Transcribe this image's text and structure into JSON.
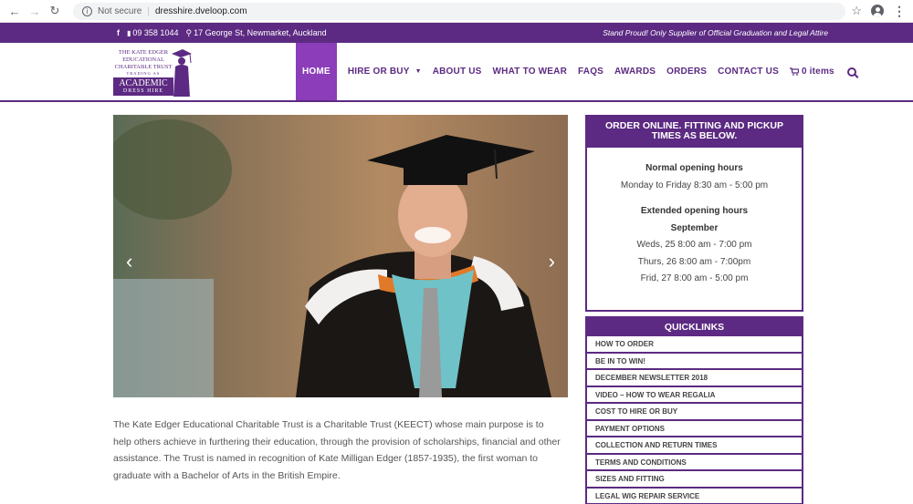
{
  "browser": {
    "not_secure": "Not secure",
    "url": "dresshire.dveloop.com"
  },
  "topbar": {
    "phone": "09 358 1044",
    "address": "17 George St, Newmarket, Auckland",
    "tagline": "Stand Proud! Only Supplier of Official Graduation and Legal Attire"
  },
  "logo": {
    "line1": "THE KATE EDGER",
    "line2": "EDUCATIONAL",
    "line3": "CHARITABLE TRUST",
    "line4": "TRADING AS",
    "block_title": "ACADEMIC",
    "block_sub": "DRESS HIRE"
  },
  "nav": {
    "items": [
      {
        "label": "HOME"
      },
      {
        "label": "HIRE OR BUY"
      },
      {
        "label": "ABOUT US"
      },
      {
        "label": "WHAT TO WEAR"
      },
      {
        "label": "FAQS"
      },
      {
        "label": "AWARDS"
      },
      {
        "label": "ORDERS"
      },
      {
        "label": "CONTACT US"
      }
    ],
    "cart_label": "0 items"
  },
  "hero": {
    "prev_arrow": "‹",
    "next_arrow": "›"
  },
  "main": {
    "paragraph": "The Kate Edger Educational Charitable Trust is a Charitable Trust (KEECT) whose main purpose is to help others achieve in furthering their education, through the provision of scholarships, financial and other assistance. The Trust is named in recognition of Kate Milligan Edger (1857-1935), the first woman to graduate with a Bachelor of Arts in the British Empire."
  },
  "hours": {
    "title": "ORDER ONLINE. FITTING AND PICKUP TIMES AS BELOW.",
    "normal_heading": "Normal opening hours",
    "normal_line": "Monday to Friday 8:30 am - 5:00 pm",
    "extended_heading": "Extended opening hours",
    "extended_month": "September",
    "extended_lines": [
      "Weds, 25 8:00 am - 7:00 pm",
      "Thurs, 26 8:00 am - 7:00pm",
      "Frid, 27 8:00 am - 5:00 pm"
    ]
  },
  "quicklinks": {
    "title": "QUICKLINKS",
    "items": [
      "HOW TO ORDER",
      "BE IN TO WIN!",
      "DECEMBER NEWSLETTER 2018",
      "VIDEO – HOW TO WEAR REGALIA",
      "COST TO HIRE OR BUY",
      "PAYMENT OPTIONS",
      "COLLECTION AND RETURN TIMES",
      "TERMS AND CONDITIONS",
      "SIZES AND FITTING",
      "LEGAL WIG REPAIR SERVICE"
    ]
  },
  "colors": {
    "brand_purple": "#5c2a82",
    "active_nav": "#8b3dba"
  }
}
